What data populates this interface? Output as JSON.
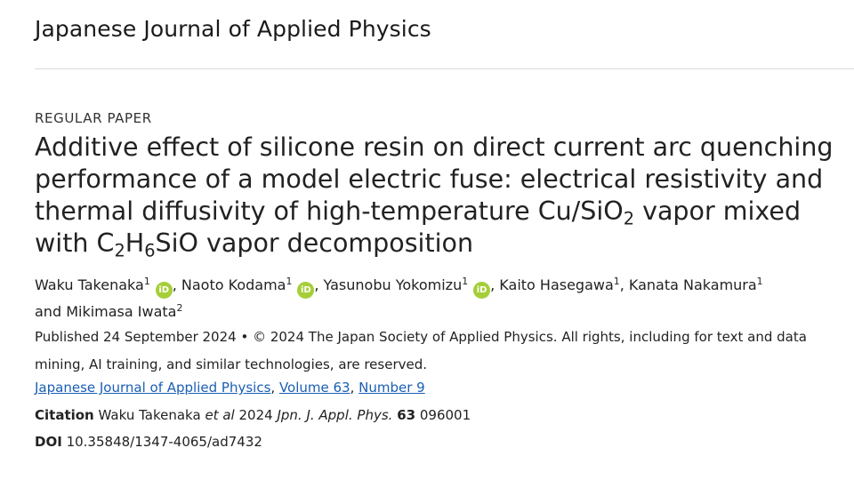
{
  "journal": {
    "name": "Japanese Journal of Applied Physics"
  },
  "article": {
    "type": "REGULAR PAPER",
    "title": {
      "part1": "Additive effect of silicone resin on direct current arc quenching performance of a model electric fuse: electrical resistivity and thermal diffusivity of high-temperature Cu/SiO",
      "sub1": "2",
      "part2": " vapor mixed with C",
      "sub2": "2",
      "part3": "H",
      "sub3": "6",
      "part4": "SiO vapor decomposition"
    },
    "authors": [
      {
        "name": "Waku Takenaka",
        "affil": "1",
        "orcid": true
      },
      {
        "name": "Naoto Kodama",
        "affil": "1",
        "orcid": true
      },
      {
        "name": "Yasunobu Yokomizu",
        "affil": "1",
        "orcid": true
      },
      {
        "name": "Kaito Hasegawa",
        "affil": "1",
        "orcid": false
      },
      {
        "name": "Kanata Nakamura",
        "affil": "1",
        "orcid": false
      },
      {
        "name": "Mikimasa Iwata",
        "affil": "2",
        "orcid": false
      }
    ],
    "authors_and": "and",
    "orcid_label": "iD",
    "published_text": "Published 24 September 2024 • © 2024 The Japan Society of Applied Physics. All rights, including for text and data mining, AI training, and similar technologies, are reserved.",
    "links": {
      "journal": "Japanese Journal of Applied Physics",
      "volume": "Volume 63",
      "number": "Number 9"
    },
    "citation": {
      "label": "Citation",
      "authors": "Waku Takenaka",
      "etal": "et al",
      "year": "2024",
      "journal_abbrev": "Jpn. J. Appl. Phys.",
      "volume": "63",
      "article_number": "096001"
    },
    "doi": {
      "label": "DOI",
      "value": "10.35848/1347-4065/ad7432"
    }
  },
  "colors": {
    "orcid_green": "#a6ce39",
    "link_blue": "#1a5fb4",
    "rule_gray": "#d9d9d9"
  }
}
